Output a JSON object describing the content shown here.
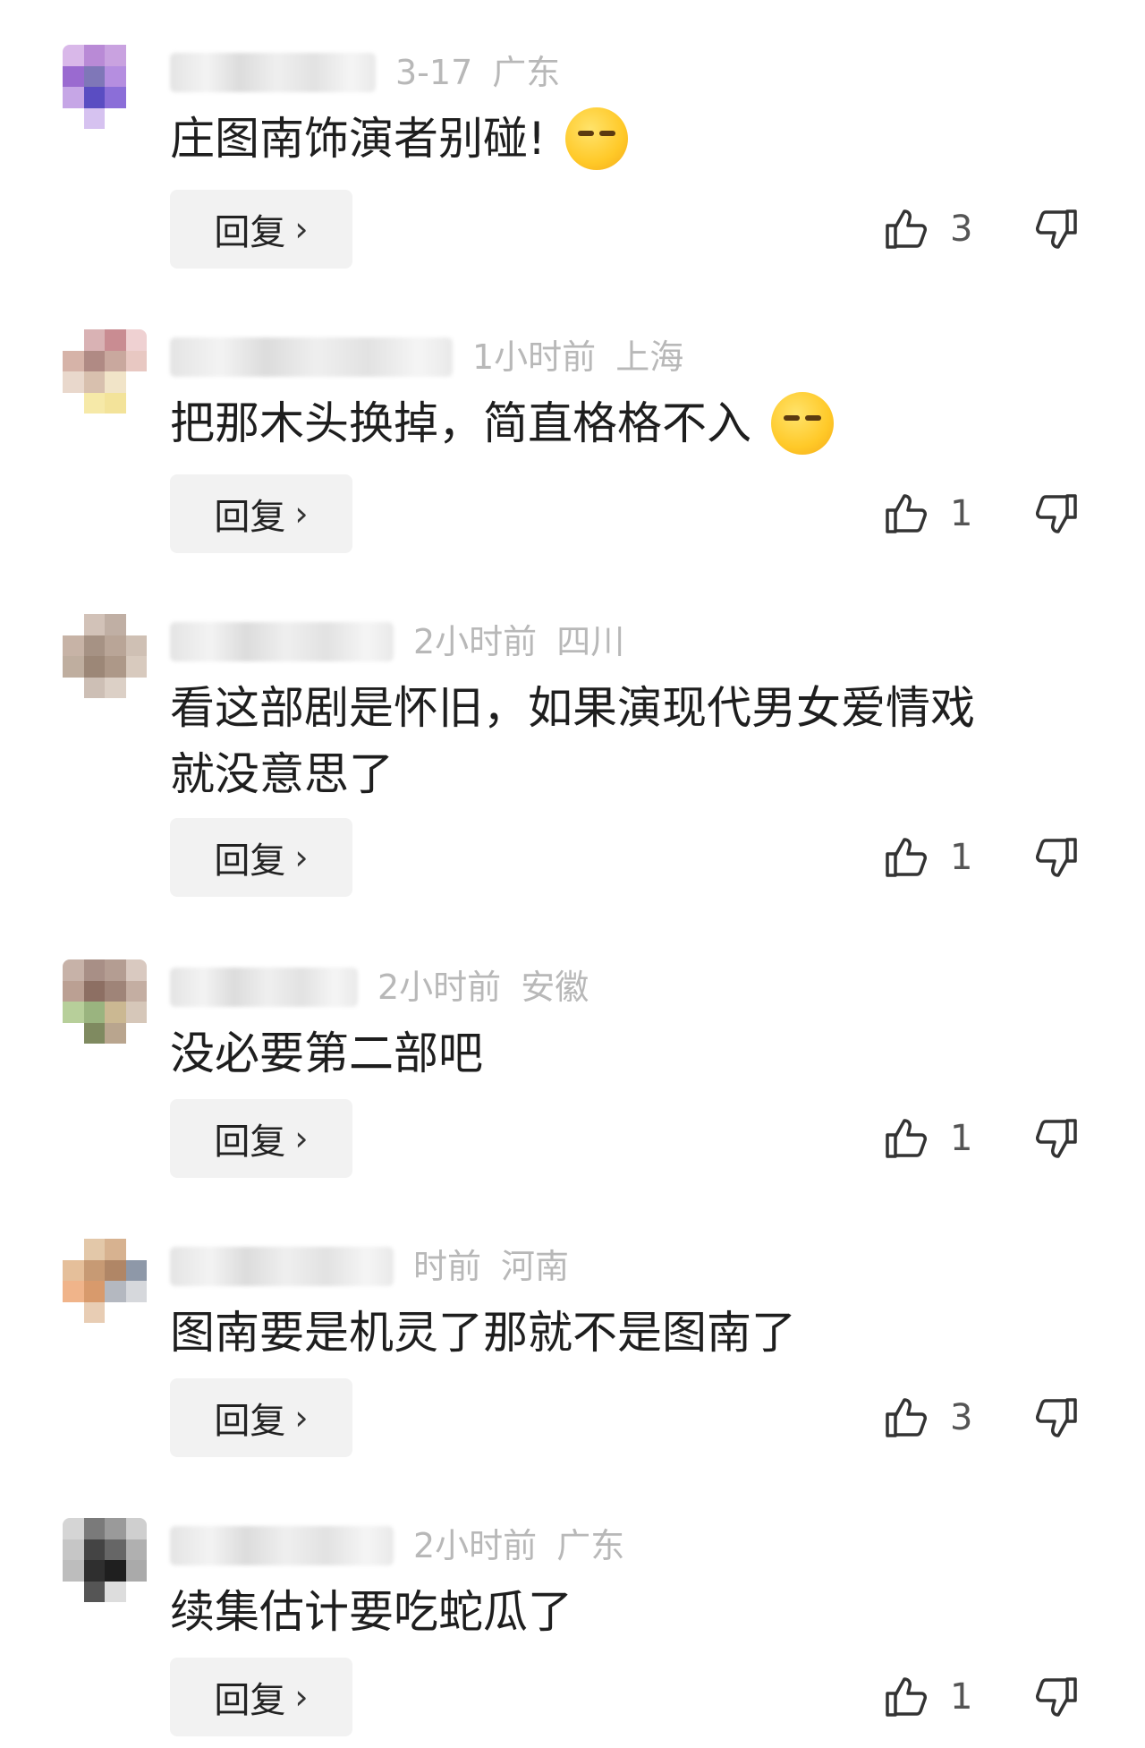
{
  "comments": [
    {
      "time": "3-17",
      "region": "广东",
      "text": "庄图南饰演者别碰!",
      "emoji": "smirk-emoji",
      "reply_label": "回复",
      "likes": "3"
    },
    {
      "time": "1小时前",
      "region": "上海",
      "text": "把那木头换掉，简直格格不入",
      "emoji": "relieved-emoji",
      "reply_label": "回复",
      "likes": "1"
    },
    {
      "time": "2小时前",
      "region": "四川",
      "text": "看这部剧是怀旧，如果演现代男女爱情戏\n就没意思了",
      "emoji": null,
      "reply_label": "回复",
      "likes": "1"
    },
    {
      "time": "2小时前",
      "region": "安徽",
      "text": "没必要第二部吧",
      "emoji": null,
      "reply_label": "回复",
      "likes": "1"
    },
    {
      "time": "时前",
      "region": "河南",
      "text": "图南要是机灵了那就不是图南了",
      "emoji": null,
      "reply_label": "回复",
      "likes": "3"
    },
    {
      "time": "2小时前",
      "region": "广东",
      "text": "续集估计要吃蛇瓜了",
      "emoji": null,
      "reply_label": "回复",
      "likes": "1"
    }
  ],
  "icons": {
    "like": "thumbs-up-icon",
    "dislike": "thumbs-down-icon",
    "reply_arrow": "chevron-right-icon"
  },
  "colors": {
    "meta": "#b8b8b8",
    "button_bg": "#f2f2f2",
    "text": "#1e1e1e"
  }
}
